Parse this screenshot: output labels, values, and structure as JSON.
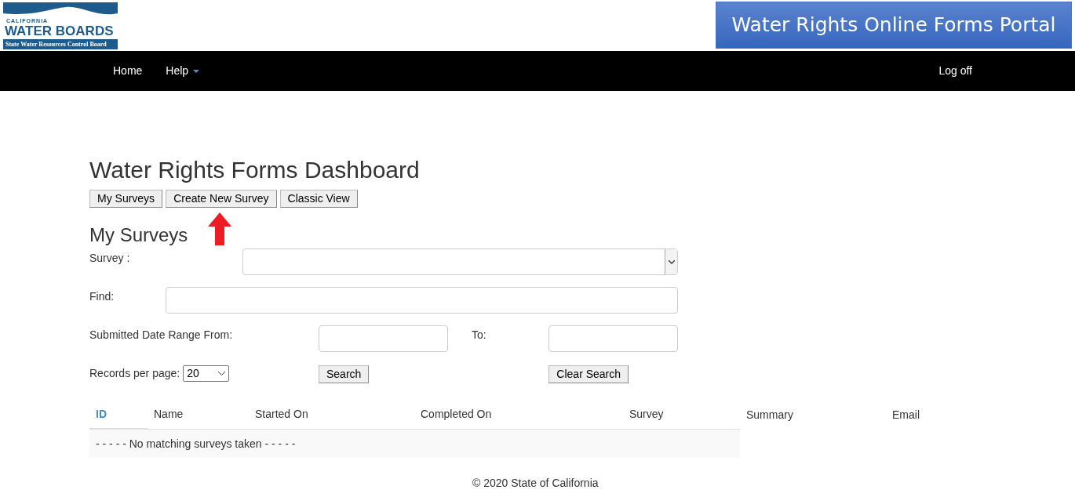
{
  "header": {
    "logo": {
      "small": "CALIFORNIA",
      "main": "WATER BOARDS",
      "sub": "State Water Resources Control Board"
    },
    "banner": "Water Rights Online Forms Portal"
  },
  "nav": {
    "items": [
      {
        "label": "Home",
        "kind": "link"
      },
      {
        "label": "Help",
        "kind": "dropdown"
      }
    ],
    "logoff": "Log off"
  },
  "page": {
    "title": "Water Rights Forms Dashboard",
    "buttons": [
      {
        "label": "My Surveys",
        "arrow_marked": false
      },
      {
        "label": "Create New Survey",
        "arrow_marked": true
      },
      {
        "label": "Classic View",
        "arrow_marked": false
      }
    ],
    "section_title": "My Surveys",
    "filters": {
      "survey_label": "Survey :",
      "find_label": "Find:",
      "date_from_label": "Submitted Date Range From:",
      "date_to_label": "To:",
      "records_label": "Records per page:",
      "records_value": "20",
      "search_button": "Search",
      "clear_button": "Clear Search"
    },
    "table": {
      "columns": [
        {
          "label": "ID",
          "sortable": true
        },
        {
          "label": "Name",
          "sortable": false
        },
        {
          "label": "Started On",
          "sortable": false
        },
        {
          "label": "Completed On",
          "sortable": false
        },
        {
          "label": "Survey",
          "sortable": false
        },
        {
          "label": "Summary",
          "sortable": false
        },
        {
          "label": "Email",
          "sortable": false
        }
      ],
      "empty_message": "- - - - - No matching surveys taken - - - - -"
    }
  },
  "footer": "© 2020 State of California"
}
